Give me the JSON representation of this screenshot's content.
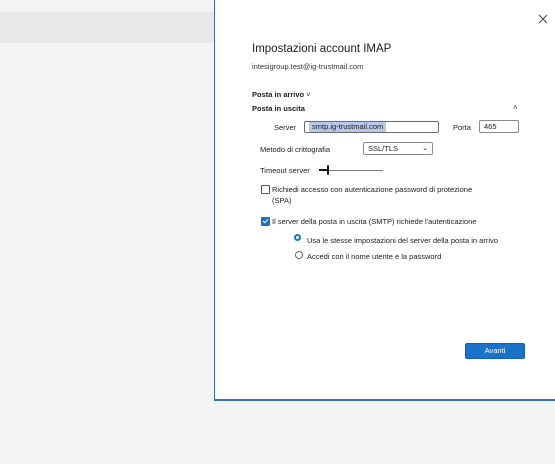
{
  "dialog": {
    "title": "Impostazioni account IMAP",
    "email": "intesigroup.test@ig-trustmail.com",
    "incoming_section": "Posta in arrivo",
    "outgoing_section": "Posta in uscita",
    "section_chevron": "˅",
    "collapse_chevron": "˄",
    "close_glyph": "✕"
  },
  "outgoing": {
    "server_label": "Server",
    "server_value": "smtp.ig-trustmail.com",
    "port_label": "Porta",
    "port_value": "465",
    "encryption_label": "Metodo di crittografia",
    "encryption_value": "SSL/TLS",
    "encryption_chevron": "⌄",
    "timeout_label": "Timeout server",
    "timeout_level": 0.14,
    "spa_label_line1": "Richiedi accesso con autenticazione password di protezione",
    "spa_label_line2": "(SPA)",
    "spa_checked": false,
    "auth_label": "Il server della posta in uscita (SMTP) richiede l'autenticazione",
    "auth_checked": true,
    "radio_same_label": "Usa le stesse impostazioni del server della posta in arrivo",
    "radio_same_selected": true,
    "radio_login_label": "Accedi con il nome utente e la password",
    "radio_login_selected": false
  },
  "actions": {
    "next_label": "Avanti"
  },
  "colors": {
    "accent": "#1a73c8",
    "selection": "#b6c9ea",
    "background": "#f3f3f3"
  }
}
